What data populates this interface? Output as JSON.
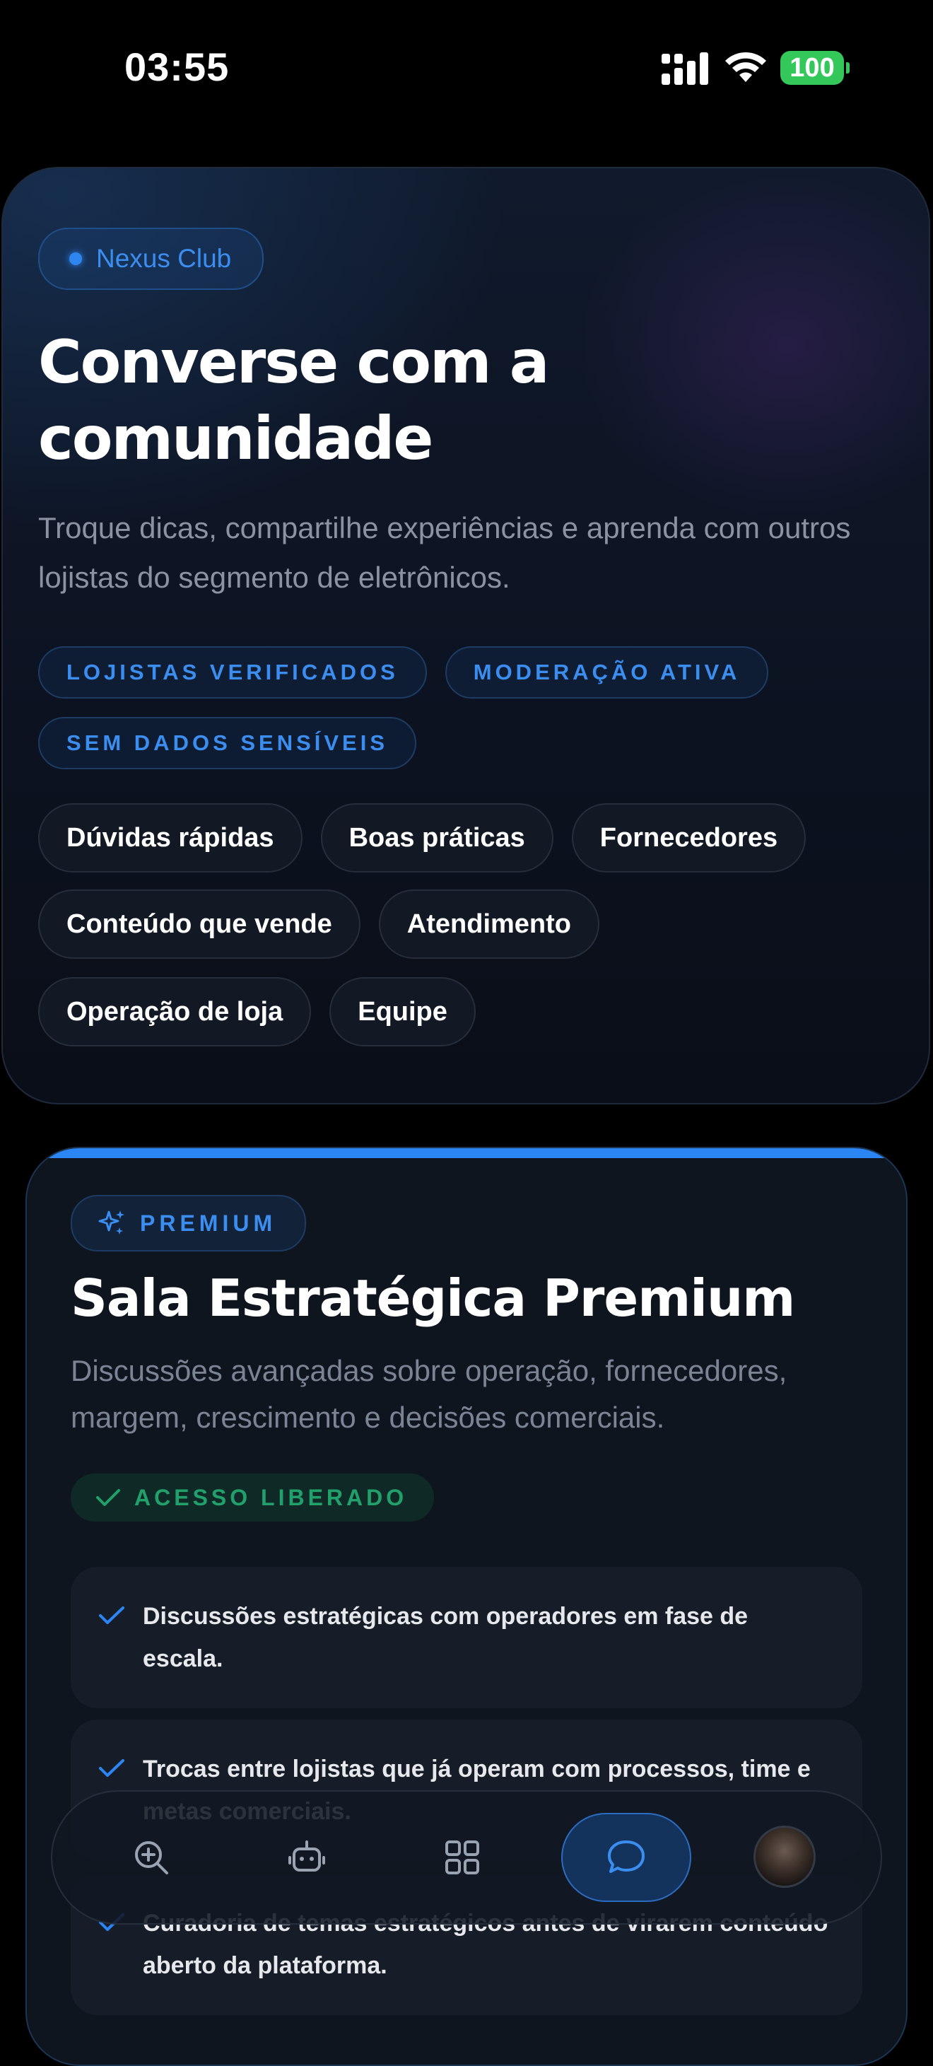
{
  "status_bar": {
    "time": "03:55",
    "battery": "100",
    "colors": {
      "battery": "#34c759"
    }
  },
  "hero": {
    "badge": "Nexus Club",
    "title": "Converse com a comunidade",
    "subtitle": "Troque dicas, compartilhe experiências e aprenda com outros lojistas do segmento de eletrônicos.",
    "tags": [
      "LOJISTAS VERIFICADOS",
      "MODERAÇÃO ATIVA",
      "SEM DADOS SENSÍVEIS"
    ],
    "topics": [
      "Dúvidas rápidas",
      "Boas práticas",
      "Fornecedores",
      "Conteúdo que vende",
      "Atendimento",
      "Operação de loja",
      "Equipe"
    ]
  },
  "premium": {
    "badge": "PREMIUM",
    "title": "Sala Estratégica Premium",
    "subtitle": "Discussões avançadas sobre operação, fornecedores, margem, crescimento e decisões comerciais.",
    "access": "ACESSO LIBERADO",
    "features": [
      "Discussões estratégicas com operadores em fase de escala.",
      "Trocas entre lojistas que já operam com processos, time e metas comerciais.",
      "Curadoria de temas estratégicos antes de virarem conteúdo aberto da plataforma."
    ],
    "colors": {
      "accent": "#2b86f3",
      "success": "#22a06b"
    }
  },
  "bottom_nav": {
    "items": [
      "search-plus-icon",
      "robot-icon",
      "grid-icon",
      "chat-icon",
      "avatar"
    ],
    "active": "chat-icon"
  }
}
